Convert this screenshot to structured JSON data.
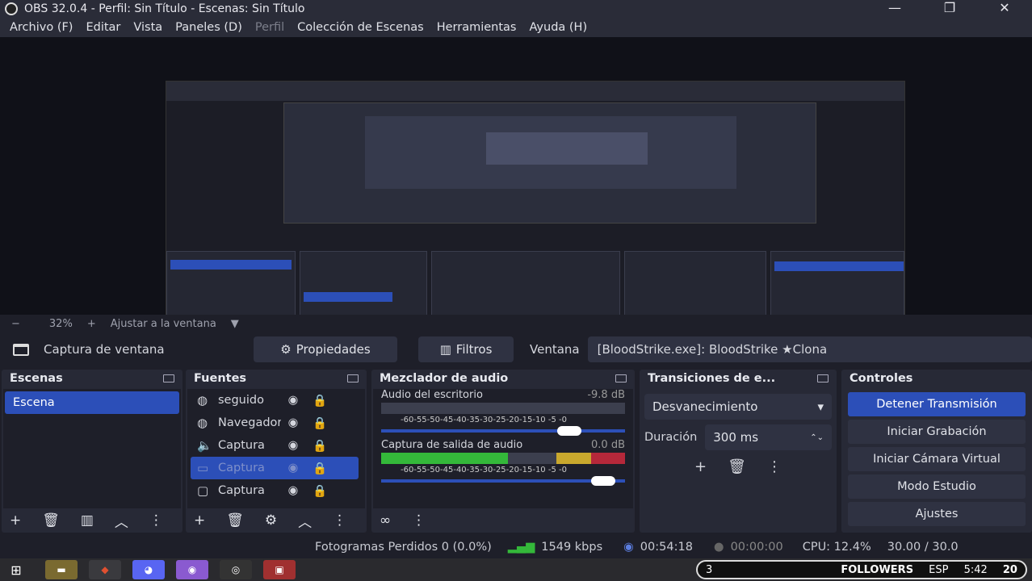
{
  "window": {
    "title": "OBS 32.0.4 - Perfil: Sin Título - Escenas: Sin Título",
    "minimize": "—",
    "restore": "❐",
    "close": "✕"
  },
  "menu": [
    {
      "label": "Archivo (F)",
      "dim": false
    },
    {
      "label": "Editar",
      "dim": false
    },
    {
      "label": "Vista",
      "dim": false
    },
    {
      "label": "Paneles (D)",
      "dim": false
    },
    {
      "label": "Perfil",
      "dim": true
    },
    {
      "label": "Colección de Escenas",
      "dim": false
    },
    {
      "label": "Herramientas",
      "dim": false
    },
    {
      "label": "Ayuda (H)",
      "dim": false
    }
  ],
  "zoom": {
    "minus": "−",
    "value": "32%",
    "plus": "+",
    "fit": "Ajustar a la ventana",
    "arrow": "▼"
  },
  "source_bar": {
    "source_name": "Captura de ventana",
    "properties": "Propiedades",
    "filters": "Filtros",
    "window_label": "Ventana",
    "window_value": "[BloodStrike.exe]: BloodStrike ★Clona"
  },
  "scenes": {
    "title": "Escenas",
    "items": [
      "Escena"
    ]
  },
  "sources": {
    "title": "Fuentes",
    "items": [
      {
        "name": "seguido",
        "icon": "globe-icon",
        "glyph": "◍"
      },
      {
        "name": "Navegador",
        "icon": "globe-icon",
        "glyph": "◍"
      },
      {
        "name": "Captura",
        "icon": "speaker-icon",
        "glyph": "🔈"
      },
      {
        "name": "Captura",
        "icon": "monitor-icon",
        "glyph": "▭"
      },
      {
        "name": "Captura",
        "icon": "window-icon",
        "glyph": "▢"
      }
    ],
    "selected_index": 3
  },
  "mixer": {
    "title": "Mezclador de audio",
    "tracks": [
      {
        "name": "Audio del escritorio",
        "db": "-9.8 dB",
        "level": 0.0,
        "volume": 0.82
      },
      {
        "name": "Captura de salida de audio",
        "db": "0.0 dB",
        "level": 0.72,
        "volume": 0.96
      }
    ],
    "scale": "-60-55-50-45-40-35-30-25-20-15-10 -5 -0"
  },
  "transitions": {
    "title": "Transiciones de e...",
    "type": "Desvanecimiento",
    "duration_label": "Duración",
    "duration_value": "300 ms"
  },
  "controls": {
    "title": "Controles",
    "buttons": [
      "Detener Transmisión",
      "Iniciar Grabación",
      "Iniciar Cámara Virtual",
      "Modo Estudio",
      "Ajustes"
    ]
  },
  "status": {
    "dropped": "Fotogramas Perdidos 0 (0.0%)",
    "bitrate": "1549 kbps",
    "stream_time": "00:54:18",
    "rec_time": "00:00:00",
    "cpu": "CPU: 12.4%",
    "fps": "30.00 / 30.0"
  },
  "taskbar": {
    "followers_count": "3",
    "followers_label": "FOLLOWERS",
    "lang": "ESP",
    "time": "5:42",
    "day": "20"
  },
  "colors": {
    "accent": "#2c4fb8",
    "panel": "#272936",
    "bg": "#1e1f29"
  }
}
